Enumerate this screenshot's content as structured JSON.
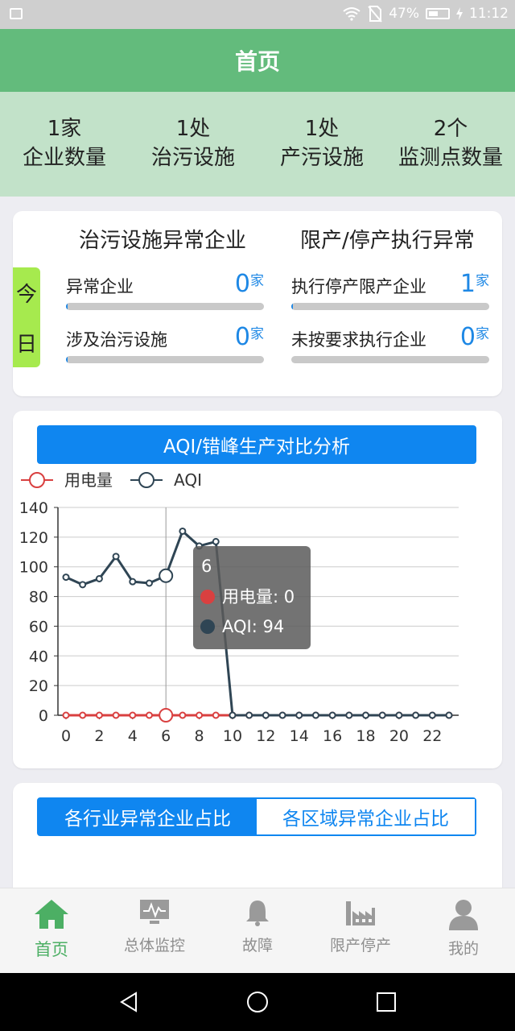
{
  "status_bar": {
    "battery": "47%",
    "time": "11:12"
  },
  "header": {
    "title": "首页"
  },
  "stats": [
    {
      "value": "1家",
      "label": "企业数量"
    },
    {
      "value": "1处",
      "label": "治污设施"
    },
    {
      "value": "1处",
      "label": "产污设施"
    },
    {
      "value": "2个",
      "label": "监测点数量"
    }
  ],
  "today": {
    "chars": [
      "今",
      "日"
    ]
  },
  "left_column": {
    "title": "治污设施异常企业",
    "items": [
      {
        "label": "异常企业",
        "value": "0",
        "unit": "家",
        "fill": 0.01
      },
      {
        "label": "涉及治污设施",
        "value": "0",
        "unit": "家",
        "fill": 0.01
      }
    ]
  },
  "right_column": {
    "title": "限产/停产执行异常",
    "items": [
      {
        "label": "执行停产限产企业",
        "value": "1",
        "unit": "家",
        "fill": 0.01
      },
      {
        "label": "未按要求执行企业",
        "value": "0",
        "unit": "家",
        "fill": 0
      }
    ]
  },
  "chart_section": {
    "title": "AQI/错峰生产对比分析"
  },
  "chart_data": {
    "type": "line",
    "x": [
      0,
      1,
      2,
      3,
      4,
      5,
      6,
      7,
      8,
      9,
      10,
      11,
      12,
      13,
      14,
      15,
      16,
      17,
      18,
      19,
      20,
      21,
      22,
      23
    ],
    "x_tick_labels": [
      "0",
      "2",
      "4",
      "6",
      "8",
      "10",
      "12",
      "14",
      "16",
      "18",
      "20",
      "22"
    ],
    "y_ticks": [
      0,
      20,
      40,
      60,
      80,
      100,
      120,
      140
    ],
    "ylim": [
      0,
      140
    ],
    "series": [
      {
        "name": "用电量",
        "color": "#d94040",
        "values": [
          0,
          0,
          0,
          0,
          0,
          0,
          0,
          0,
          0,
          0,
          0,
          0,
          0,
          0,
          0,
          0,
          0,
          0,
          0,
          0,
          0,
          0,
          0,
          0
        ]
      },
      {
        "name": "AQI",
        "color": "#2f4554",
        "values": [
          93,
          88,
          92,
          107,
          90,
          89,
          94,
          124,
          114,
          117,
          0,
          0,
          0,
          0,
          0,
          0,
          0,
          0,
          0,
          0,
          0,
          0,
          0,
          0
        ]
      }
    ],
    "legend_position": "top-left",
    "grid": true,
    "tooltip": {
      "x": 6,
      "title": "6",
      "lines": [
        "用电量: 0",
        "AQI: 94"
      ]
    }
  },
  "tabs": {
    "active": "各行业异常企业占比",
    "inactive": "各区域异常企业占比"
  },
  "bottom_nav": [
    {
      "label": "首页",
      "icon": "home-icon",
      "active": true
    },
    {
      "label": "总体监控",
      "icon": "monitor-icon",
      "active": false
    },
    {
      "label": "故障",
      "icon": "bell-icon",
      "active": false
    },
    {
      "label": "限产停产",
      "icon": "factory-icon",
      "active": false
    },
    {
      "label": "我的",
      "icon": "user-icon",
      "active": false
    }
  ]
}
